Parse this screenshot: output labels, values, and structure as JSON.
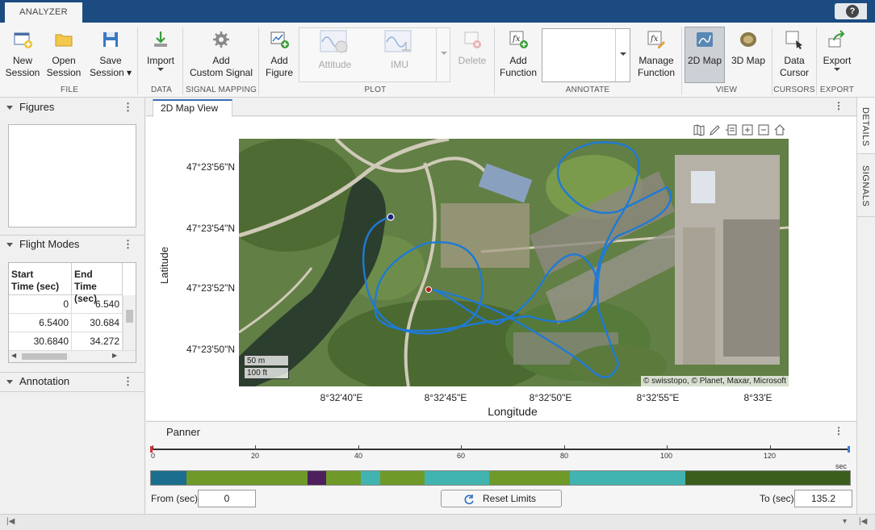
{
  "app": {
    "tab": "ANALYZER",
    "help": "?"
  },
  "ribbon": {
    "new_session": "New\nSession",
    "open_session": "Open\nSession",
    "save_session": "Save\nSession",
    "import": "Import",
    "add_custom_signal": "Add\nCustom Signal",
    "add_figure": "Add\nFigure",
    "attitude": "Attitude",
    "imu": "IMU",
    "delete": "Delete",
    "add_function": "Add\nFunction",
    "annotate_value": "",
    "manage_function": "Manage\nFunction",
    "map2d": "2D Map",
    "map3d": "3D Map",
    "data_cursor": "Data\nCursor",
    "export": "Export",
    "sections": {
      "file": "FILE",
      "data": "DATA",
      "signal_mapping": "SIGNAL MAPPING",
      "plot": "PLOT",
      "annotate": "ANNOTATE",
      "view": "VIEW",
      "cursors": "CURSORS",
      "export": "EXPORT"
    }
  },
  "left": {
    "figures": "Figures",
    "flight_modes": "Flight Modes",
    "annotation": "Annotation",
    "table": {
      "col1": "Start\nTime (sec)",
      "col2": "End\nTime (sec)",
      "rows": [
        [
          "0",
          "6.540"
        ],
        [
          "6.5400",
          "30.684"
        ],
        [
          "30.6840",
          "34.272"
        ]
      ]
    }
  },
  "main": {
    "tab": "2D Map View",
    "latitude_label": "Latitude",
    "longitude_label": "Longitude",
    "lat_ticks": [
      "47°23'56\"N",
      "47°23'54\"N",
      "47°23'52\"N",
      "47°23'50\"N"
    ],
    "lon_ticks": [
      "8°32'40\"E",
      "8°32'45\"E",
      "8°32'50\"E",
      "8°32'55\"E",
      "8°33'E"
    ],
    "scale_m": "50 m",
    "scale_ft": "100 ft",
    "attribution": "© swisstopo, © Planet, Maxar, Microsoft",
    "colors": {
      "track": "#1f7ad6",
      "start": "#1a237e",
      "end": "#b71c1c"
    }
  },
  "right_tabs": {
    "details": "DETAILS",
    "signals": "SIGNALS"
  },
  "panner": {
    "title": "Panner",
    "ticks": [
      "0",
      "20",
      "40",
      "60",
      "80",
      "100",
      "120"
    ],
    "unit": "sec",
    "from_label": "From (sec)",
    "from_value": "0",
    "reset": "Reset Limits",
    "to_label": "To (sec)",
    "to_value": "135.2",
    "segment_colors": [
      "#1b6e8e",
      "#6f9a2a",
      "#4e1f5d",
      "#6f9a2a",
      "#41b3b0",
      "#6f9a2a",
      "#41b3b0",
      "#6f9a2a",
      "#41b3b0",
      "#3c5e1d"
    ]
  }
}
